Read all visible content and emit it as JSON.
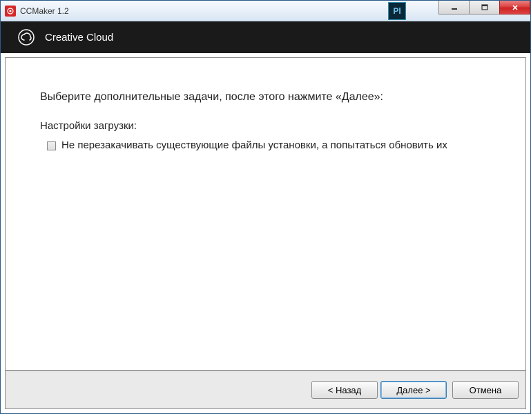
{
  "window": {
    "title": "CCMaker 1.2"
  },
  "header": {
    "title": "Creative Cloud"
  },
  "content": {
    "instruction": "Выберите дополнительные задачи, после этого нажмите «Далее»:",
    "section_label": "Настройки загрузки:",
    "checkbox_label": "Не перезакачивать существующие файлы установки, а попытаться обновить их"
  },
  "buttons": {
    "back": "< Назад",
    "next": "Далее >",
    "cancel": "Отмена"
  },
  "bg_app": "Pl"
}
